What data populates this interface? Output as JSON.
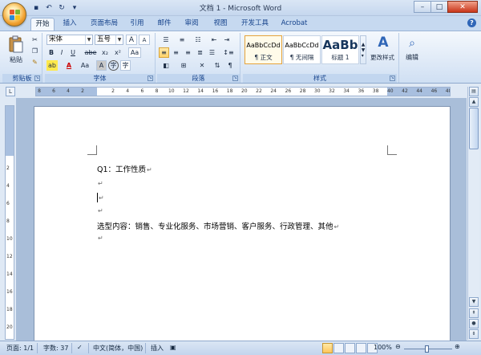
{
  "window": {
    "title": "文档 1 - Microsoft Word",
    "minimize": "–",
    "maximize": "□",
    "close": "✕"
  },
  "qat": {
    "save": "▪",
    "undo": "↶",
    "redo": "↻",
    "more": "▾"
  },
  "tabs": [
    "开始",
    "插入",
    "页面布局",
    "引用",
    "邮件",
    "审阅",
    "视图",
    "开发工具",
    "Acrobat"
  ],
  "help": "?",
  "ribbon": {
    "clipboard": {
      "label": "剪贴板",
      "paste": "粘贴"
    },
    "font": {
      "label": "字体",
      "font_name": "宋体",
      "font_size": "五号",
      "grow": "A",
      "shrink": "A",
      "bold": "B",
      "italic": "I",
      "underline": "U",
      "strike": "abe",
      "subscript": "x₂",
      "superscript": "x²",
      "clear": "Aa",
      "highlight": "ab",
      "font_color": "A",
      "change_case": "Aa",
      "char_shading": "A",
      "char_border": "字"
    },
    "paragraph": {
      "label": "段落"
    },
    "styles": {
      "label": "样式",
      "items": [
        {
          "sample": "AaBbCcDd",
          "name": "¶ 正文"
        },
        {
          "sample": "AaBbCcDd",
          "name": "¶ 无间隔"
        },
        {
          "sample": "AaBb",
          "name": "标题 1"
        }
      ],
      "change_styles": "更改样式"
    },
    "editing": {
      "label": "编辑"
    }
  },
  "ruler": {
    "h_ticks": [
      "8",
      "6",
      "4",
      "2",
      "2",
      "4",
      "6",
      "8",
      "10",
      "12",
      "14",
      "16",
      "18",
      "20",
      "22",
      "24",
      "26",
      "28",
      "30",
      "32",
      "34",
      "36",
      "38",
      "40",
      "42",
      "44",
      "46",
      "48"
    ],
    "v_ticks": [
      "2",
      "4",
      "6",
      "8",
      "10",
      "12",
      "14",
      "16",
      "18",
      "20"
    ]
  },
  "document": {
    "para_mark": "↵",
    "paragraphs": [
      "Q1：工作性质",
      "",
      "",
      "",
      "选型内容：销售、专业化服务、市场营销、客户服务、行政管理、其他",
      ""
    ]
  },
  "statusbar": {
    "page": "页面: 1/1",
    "words": "字数: 37",
    "language": "中文(简体，中国)",
    "insert_mode": "插入",
    "zoom": "100%",
    "zoom_minus": "⊖",
    "zoom_plus": "⊕"
  },
  "colors": {
    "accent": "#2f66b7",
    "ribbon": "#dbe7f6",
    "highlight": "#ffd36b"
  }
}
